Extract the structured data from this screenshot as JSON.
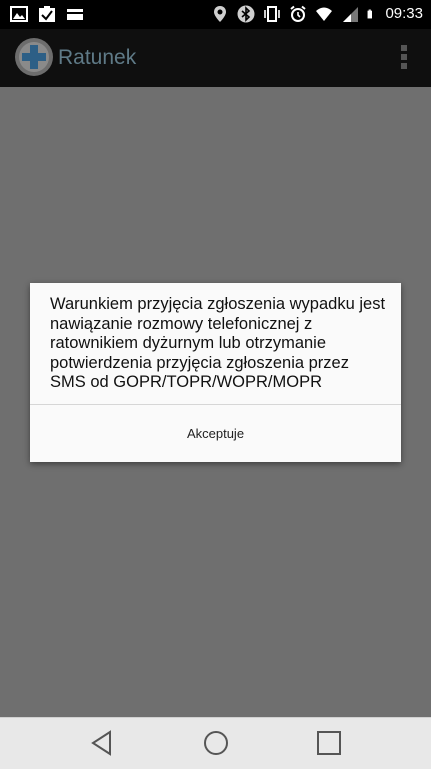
{
  "status_bar": {
    "time": "09:33",
    "left_icons": [
      "image-icon",
      "clipboard-check-icon",
      "card-icon"
    ],
    "right_icons": [
      "location-icon",
      "bluetooth-icon",
      "vibrate-icon",
      "alarm-icon",
      "wifi-icon",
      "signal-icon",
      "battery-icon"
    ]
  },
  "action_bar": {
    "title": "Ratunek",
    "logo_icon": "medical-cross-icon",
    "menu_icon": "overflow-menu-icon"
  },
  "dialog": {
    "message": "Warunkiem przyjęcia zgłoszenia wypadku jest nawiązanie rozmowy telefonicznej z ratownikiem dyżurnym lub otrzymanie potwierdzenia przyjęcia zgłoszenia przez SMS od GOPR/TOPR/WOPR/MOPR",
    "button_label": "Akceptuje"
  },
  "nav_bar": {
    "buttons": [
      "back-icon",
      "home-icon",
      "recents-icon"
    ]
  },
  "colors": {
    "overlay": "#6f6f6f",
    "status_bar": "#000000",
    "action_bar": "#0f0f0f",
    "title_dimmed": "#5f7a87",
    "dialog_bg": "#fafafa",
    "nav_bar": "#e8e8e8"
  }
}
